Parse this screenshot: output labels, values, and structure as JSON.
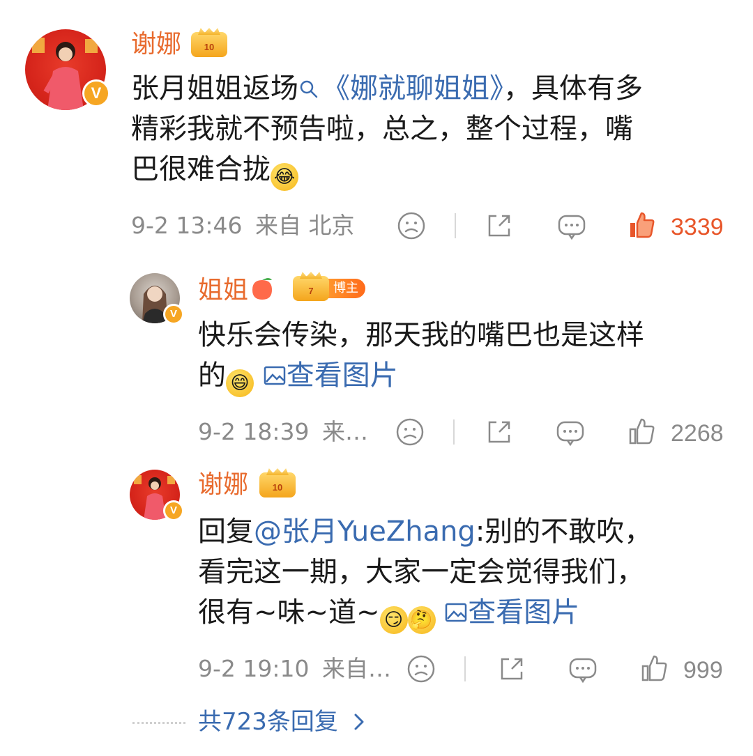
{
  "comment": {
    "author": "谢娜",
    "level_badge": "10",
    "text_prefix": "张月姐姐返场",
    "topic_link": "《娜就聊姐姐》",
    "text_line1_rest": "，具体有多",
    "text_line2": "精彩我就不预告啦，总之，整个过程，嘴",
    "text_line3": "巴很难合拢",
    "date": "9-2",
    "time": "13:46",
    "source": "来自 北京",
    "likes": "3339",
    "liked": true
  },
  "replies": [
    {
      "author": "姐姐",
      "level_badge": "7",
      "role_tag": "博主",
      "text_line1": "快乐会传染，那天我的嘴巴也是这样",
      "text_line2": "的",
      "view_image": "查看图片",
      "date": "9-2",
      "time": "18:39",
      "source": "来…",
      "likes": "2268"
    },
    {
      "author": "谢娜",
      "level_badge": "10",
      "reply_prefix": "回复",
      "mention": "@张月YueZhang",
      "text_line1_rest": ":别的不敢吹，",
      "text_line2": "看完这一期，大家一定会觉得我们，",
      "text_line3": "很有~味~道~",
      "view_image": "查看图片",
      "date": "9-2",
      "time": "19:10",
      "source": "来自…",
      "likes": "999"
    }
  ],
  "total_replies": "共723条回复",
  "colors": {
    "name": "#e86b2e",
    "link": "#3a6bb0",
    "meta": "#8a8a8a",
    "like_active": "#e8562a"
  }
}
